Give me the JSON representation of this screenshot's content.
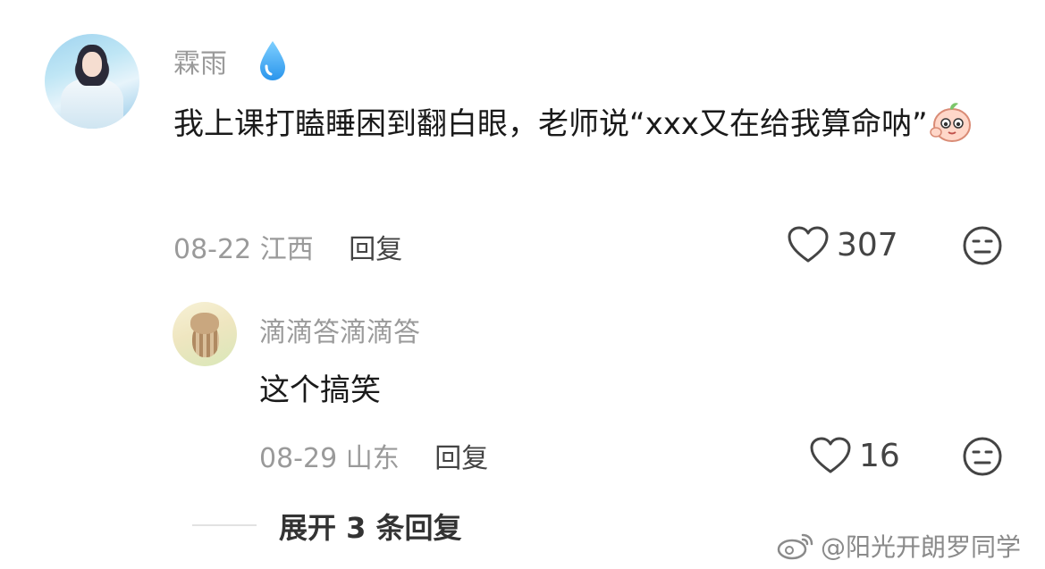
{
  "comment": {
    "username": "霖雨",
    "badge_icon": "water-drop-icon",
    "text": "我上课打瞌睡困到翻白眼，老师说“xxx又在给我算命呐”",
    "emoji_icon": "peach-emoji-icon",
    "date": "08-22",
    "location": "江西",
    "reply_label": "回复",
    "likes": "307",
    "dislike_icon": "meh-face-icon"
  },
  "reply": {
    "username": "滴滴答滴滴答",
    "text": "这个搞笑",
    "date": "08-29",
    "location": "山东",
    "reply_label": "回复",
    "likes": "16",
    "dislike_icon": "meh-face-icon"
  },
  "expand_label": "展开 3 条回复",
  "watermark": "@阳光开朗罗同学",
  "colors": {
    "drop_blue": "#3da9f5",
    "muted_text": "#9a9a9a",
    "body_text": "#1a1a1a"
  }
}
